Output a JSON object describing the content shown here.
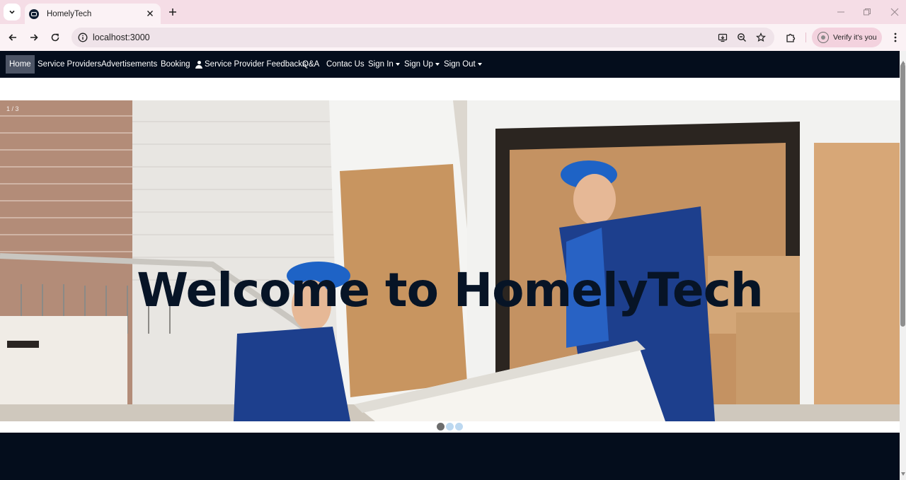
{
  "browser": {
    "tab_title": "HomelyTech",
    "url": "localhost:3000",
    "verify_label": "Verify it's you",
    "colors": {
      "tabbar": "#f5dde6",
      "toolbar": "#fbf2f5",
      "omnibox": "#efe3e9"
    },
    "icons": [
      "tab-search-icon",
      "close-icon",
      "plus-icon",
      "minimize-icon",
      "restore-icon",
      "back-arrow-icon",
      "forward-arrow-icon",
      "reload-icon",
      "site-info-icon",
      "install-app-icon",
      "zoom-icon",
      "star-icon",
      "extensions-icon",
      "kebab-menu-icon"
    ]
  },
  "navbar": {
    "items": [
      {
        "label": "Home",
        "active": true
      },
      {
        "label": "Service Providers"
      },
      {
        "label": "Advertisements"
      },
      {
        "label": "Booking"
      },
      {
        "label": "Service Provider Feedbacks",
        "icon": "person-icon"
      },
      {
        "label": "Q&A"
      },
      {
        "label": "Contac Us"
      },
      {
        "label": "Sign In",
        "dropdown": true
      },
      {
        "label": "Sign Up",
        "dropdown": true
      },
      {
        "label": "Sign Out",
        "dropdown": true
      }
    ],
    "colors": {
      "background": "#040d1c",
      "active": "#4d5566"
    }
  },
  "carousel": {
    "counter": "1 / 3",
    "caption": "Welcome to HomelyTech",
    "current_slide": 1,
    "total_slides": 3
  }
}
